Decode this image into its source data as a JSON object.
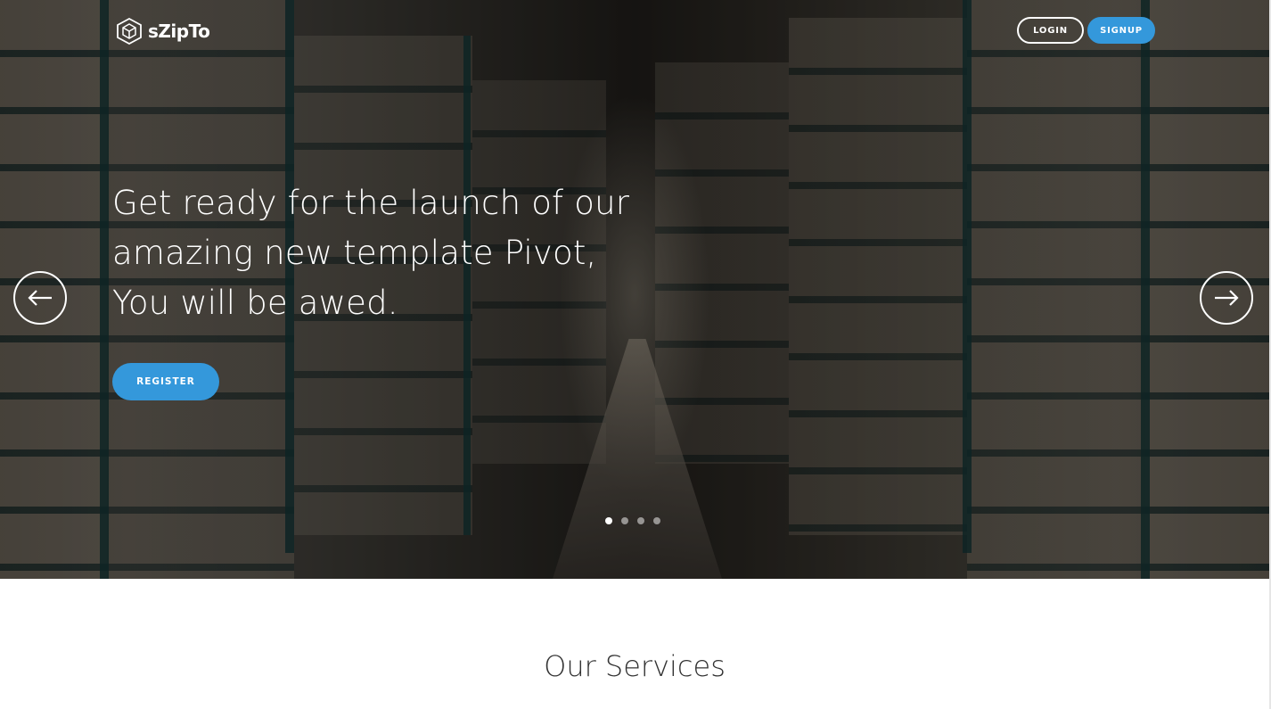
{
  "header": {
    "logo_text": "sZipTo",
    "login_label": "LOGIN",
    "signup_label": "SIGNUP"
  },
  "hero": {
    "headline": "Get ready for the launch of our amazing new template Pivot, You will be awed.",
    "register_label": "REGISTER",
    "slides_total": 4,
    "active_slide": 1
  },
  "services": {
    "title": "Our Services"
  },
  "colors": {
    "accent": "#3498db",
    "text_dark": "#333333",
    "white": "#ffffff"
  },
  "icons": {
    "logo": "cube-icon",
    "prev": "arrow-left-icon",
    "next": "arrow-right-icon"
  }
}
